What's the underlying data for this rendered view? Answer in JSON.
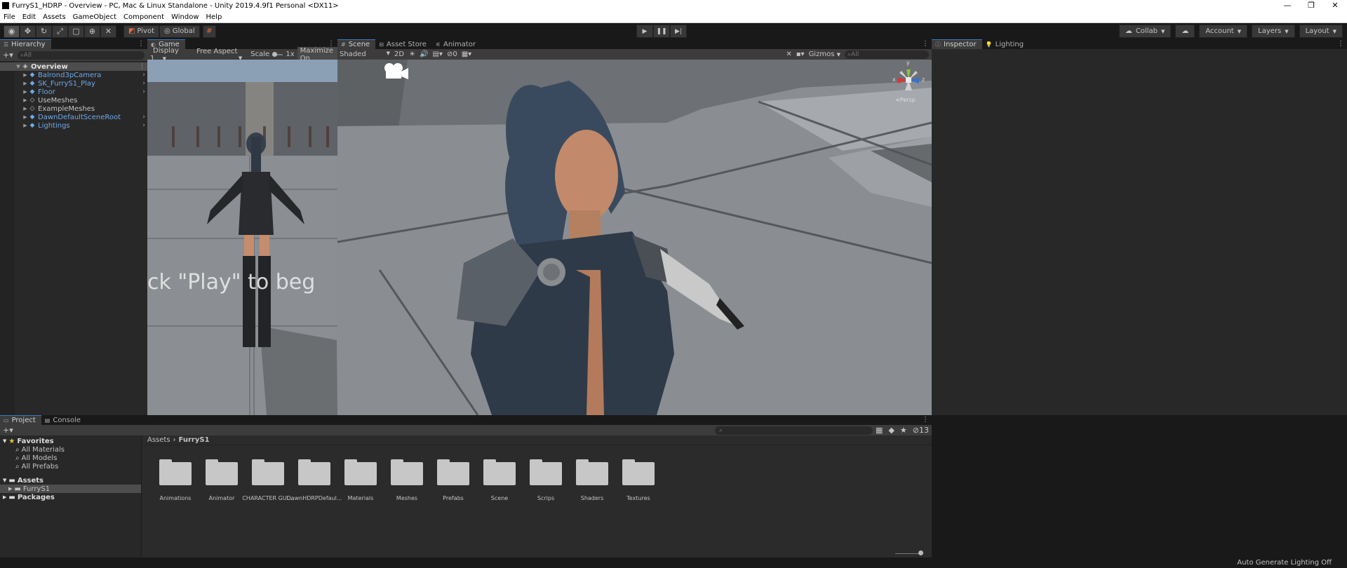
{
  "title": "FurryS1_HDRP - Overview - PC, Mac & Linux Standalone - Unity 2019.4.9f1 Personal <DX11>",
  "window_buttons": [
    "—",
    "❐",
    "✕"
  ],
  "menu": [
    "File",
    "Edit",
    "Assets",
    "GameObject",
    "Component",
    "Window",
    "Help"
  ],
  "toolbar": {
    "pivot_label": "Pivot",
    "global_label": "Global",
    "collab_label": "Collab",
    "account_label": "Account",
    "layers_label": "Layers",
    "layout_label": "Layout"
  },
  "hierarchy": {
    "tab_label": "Hierarchy",
    "search_placeholder": "All",
    "scene_name": "Overview",
    "items": [
      "Balrond3pCamera",
      "SK_FurryS1_Play",
      "Floor",
      "UseMeshes",
      "ExampleMeshes",
      "DawnDefaultSceneRoot",
      "Lightings"
    ]
  },
  "game": {
    "tab_label": "Game",
    "display": "Display 1",
    "aspect": "Free Aspect",
    "scale_label": "Scale",
    "scale_value": "1x",
    "maximize_label": "Maximize On",
    "overlay_text": "ck \"Play\" to beg"
  },
  "scene": {
    "tabs": [
      "Scene",
      "Asset Store",
      "Animator"
    ],
    "shading": "Shaded",
    "mode_2d": "2D",
    "hidden_count": "0",
    "gizmos_label": "Gizmos",
    "search_placeholder": "All",
    "persp_label": "Persp",
    "axis_labels": {
      "y": "y",
      "x": "x",
      "z": "z"
    }
  },
  "inspector": {
    "tabs": [
      "Inspector",
      "Lighting"
    ]
  },
  "project": {
    "tabs": [
      "Project",
      "Console"
    ],
    "favorites_label": "Favorites",
    "favorites": [
      "All Materials",
      "All Models",
      "All Prefabs"
    ],
    "assets_label": "Assets",
    "assets_child": "FurryS1",
    "packages_label": "Packages",
    "breadcrumb": [
      "Assets",
      "FurryS1"
    ],
    "hidden_count": "13",
    "folders": [
      "Animations",
      "Animator",
      "CHARACTER GUI...",
      "DawnHDRPDefaul...",
      "Materials",
      "Meshes",
      "Prefabs",
      "Scene",
      "Scrips",
      "Shaders",
      "Textures"
    ]
  },
  "status": {
    "text": "Auto Generate Lighting Off"
  },
  "colors": {
    "accent_blue": "#3a79bb",
    "prefab_blue": "#6fa9e8",
    "snap_orange": "#e07040"
  }
}
